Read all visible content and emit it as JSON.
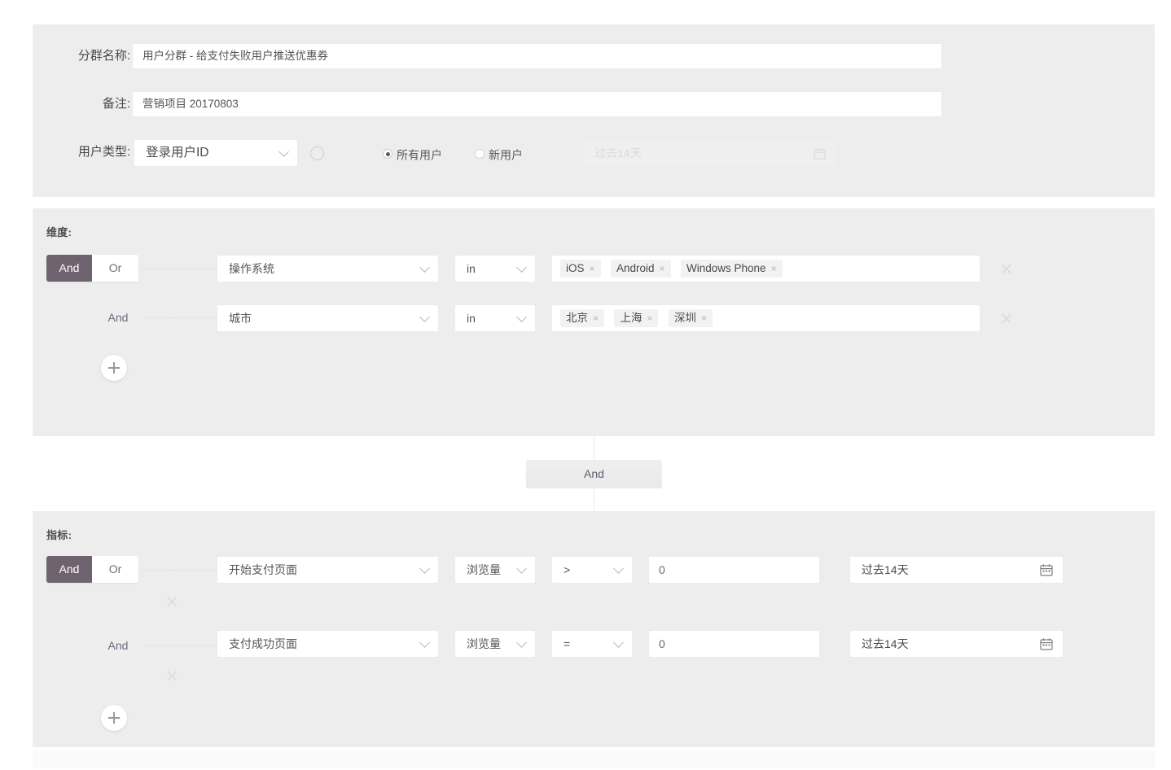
{
  "basic": {
    "name_label": "分群名称:",
    "name_value": "用户分群 - 给支付失败用户推送优惠券",
    "note_label": "备注:",
    "note_value": "营销项目 20170803",
    "usertype_label": "用户类型:",
    "usertype_value": "登录用户ID",
    "help_icon": "circle-icon",
    "radio_all": "所有用户",
    "radio_new": "新用户",
    "date_disabled_value": "过去14天",
    "calendar_icon": "calendar-icon"
  },
  "dimension": {
    "title": "维度:",
    "logic": {
      "and": "And",
      "or": "Or"
    },
    "rows": [
      {
        "field": "操作系统",
        "operator": "in",
        "tags": [
          "iOS",
          "Android",
          "Windows Phone"
        ],
        "remove": "×"
      },
      {
        "connector": "And",
        "field": "城市",
        "operator": "in",
        "tags": [
          "北京",
          "上海",
          "深圳"
        ],
        "remove": "×"
      }
    ],
    "add_label": "plus-icon"
  },
  "middle_connector": {
    "label": "And"
  },
  "metric": {
    "title": "指标:",
    "logic": {
      "and": "And",
      "or": "Or"
    },
    "rows": [
      {
        "event": "开始支付页面",
        "measure": "浏览量",
        "comparator": ">",
        "value": "0",
        "date": "过去14天",
        "remove": "×"
      },
      {
        "connector": "And",
        "event": "支付成功页面",
        "measure": "浏览量",
        "comparator": "=",
        "value": "0",
        "date": "过去14天",
        "remove": "×"
      }
    ],
    "add_label": "plus-icon"
  },
  "colors": {
    "accent": "#6f6370",
    "panel_bg": "#ededed",
    "page_bg": "#ffffff",
    "field_bg": "#ffffff",
    "tag_bg": "#f2f2f2",
    "muted_text": "#b5b5b5"
  }
}
